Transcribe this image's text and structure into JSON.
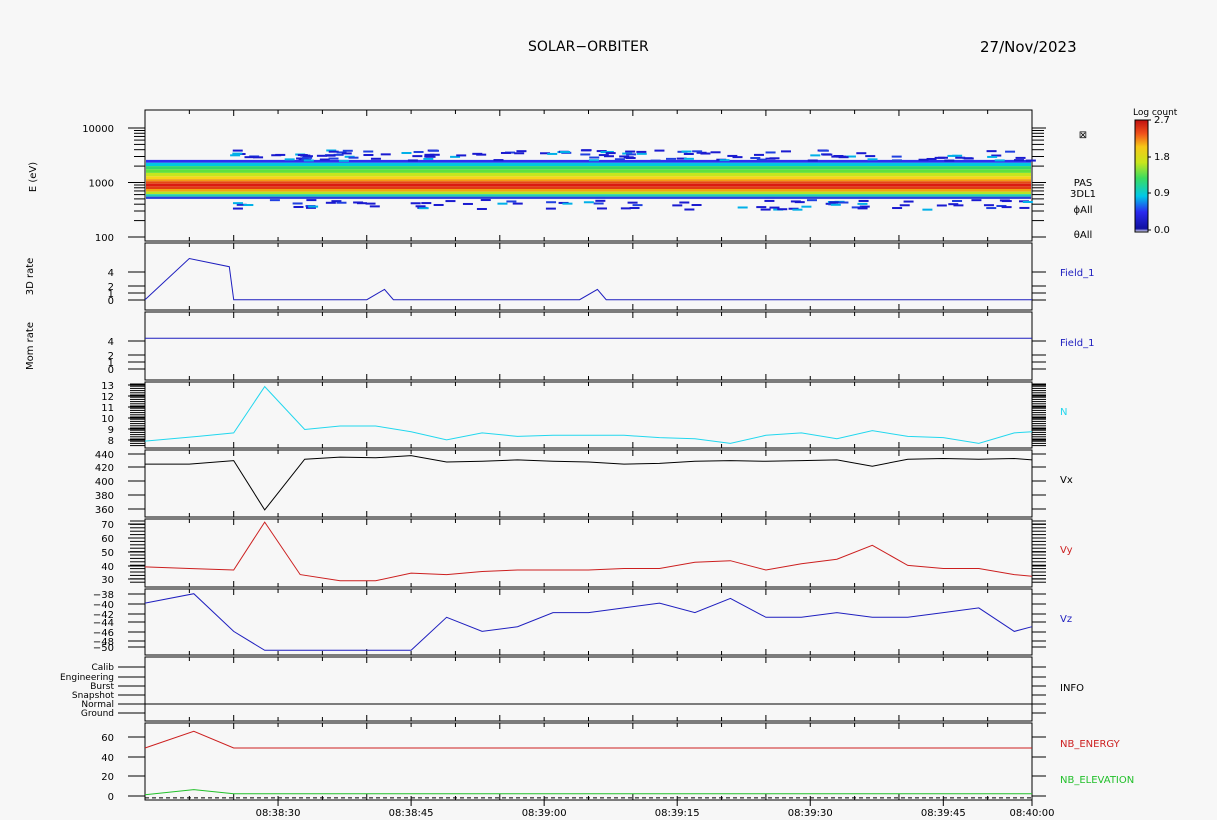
{
  "header": {
    "title": "SOLAR−ORBITER",
    "date": "27/Nov/2023"
  },
  "chart_data": [
    {
      "type": "heatmap",
      "panel": "spectrogram",
      "ylabel": "E (eV)",
      "yscale": "log",
      "yticks": [
        {
          "v": 10000,
          "label": "10000"
        },
        {
          "v": 1000,
          "label": "1000"
        },
        {
          "v": 100,
          "label": "100"
        }
      ],
      "ylim": [
        100,
        10000
      ],
      "right_labels": [
        "⊠",
        "PAS",
        "3DL1",
        "ϕAll",
        "θAll"
      ],
      "colorbar": {
        "title": "Log count",
        "ticks": [
          "2.7",
          "1.8",
          "0.9",
          "0.0"
        ],
        "range": [
          0.0,
          2.7
        ]
      },
      "band": {
        "e_min": 450,
        "e_max": 2600,
        "e_peak": 900
      }
    },
    {
      "type": "line",
      "panel": "rate3d",
      "ylabel": "3D rate",
      "yticks": [
        "4",
        "2",
        "1",
        "0"
      ],
      "ylim": [
        0,
        6.5
      ],
      "series": [
        {
          "name": "Field_1",
          "color": "#1f1fbf",
          "x": [
            0,
            5,
            9.5,
            10,
            25,
            27,
            28,
            49,
            51,
            52,
            100
          ],
          "y": [
            1,
            5,
            4.2,
            1,
            1,
            2,
            1,
            1,
            2,
            1,
            1
          ]
        }
      ]
    },
    {
      "type": "line",
      "panel": "momrate",
      "ylabel": "Mom rate",
      "yticks": [
        "4",
        "2",
        "1",
        "0"
      ],
      "ylim": [
        0,
        6.5
      ],
      "series": [
        {
          "name": "Field_1",
          "color": "#1f1fbf",
          "x": [
            0,
            100
          ],
          "y": [
            4,
            4
          ]
        }
      ]
    },
    {
      "type": "line",
      "panel": "density",
      "yticks": [
        "13",
        "12",
        "11",
        "10",
        "9",
        "8"
      ],
      "ylim": [
        7.5,
        13.2
      ],
      "series": [
        {
          "name": "N",
          "color": "#22d7ee",
          "x": [
            0,
            6,
            10,
            13.5,
            18,
            22,
            26,
            30,
            34,
            38,
            42,
            46,
            50,
            54,
            58,
            62,
            66,
            70,
            74,
            78,
            82,
            86,
            90,
            94,
            98,
            100
          ],
          "y": [
            8.1,
            8.5,
            8.8,
            12.8,
            9.1,
            9.4,
            9.4,
            8.9,
            8.2,
            8.8,
            8.5,
            8.6,
            8.6,
            8.6,
            8.4,
            8.3,
            7.9,
            8.6,
            8.8,
            8.3,
            9.0,
            8.5,
            8.4,
            7.9,
            8.8,
            8.9
          ]
        }
      ]
    },
    {
      "type": "line",
      "panel": "vx",
      "yticks": [
        "440",
        "420",
        "400",
        "380",
        "360"
      ],
      "ylim": [
        350,
        445
      ],
      "series": [
        {
          "name": "Vx",
          "color": "#000000",
          "x": [
            0,
            5,
            10,
            13.5,
            18,
            22,
            26,
            30,
            34,
            38,
            42,
            46,
            50,
            54,
            58,
            62,
            66,
            70,
            74,
            78,
            82,
            86,
            90,
            94,
            98,
            100
          ],
          "y": [
            425,
            425,
            430,
            360,
            432,
            435,
            434,
            437,
            428,
            429,
            431,
            429,
            428,
            425,
            426,
            429,
            430,
            429,
            430,
            431,
            422,
            432,
            433,
            432,
            433,
            431
          ]
        }
      ]
    },
    {
      "type": "line",
      "panel": "vy",
      "yticks": [
        "70",
        "60",
        "50",
        "40",
        "30"
      ],
      "ylim": [
        28,
        72
      ],
      "series": [
        {
          "name": "Vy",
          "color": "#cc1f1f",
          "x": [
            0,
            5,
            10,
            13.5,
            17.5,
            22,
            26,
            30,
            34,
            38,
            42,
            46,
            50,
            54,
            58,
            62,
            66,
            70,
            74,
            78,
            82,
            86,
            90,
            94,
            98,
            100
          ],
          "y": [
            41,
            40,
            39,
            70,
            36,
            32,
            32,
            37,
            36,
            38,
            39,
            39,
            39,
            40,
            40,
            44,
            45,
            39,
            43,
            46,
            55,
            42,
            40,
            40,
            36,
            35
          ]
        }
      ]
    },
    {
      "type": "line",
      "panel": "vz",
      "yticks": [
        "−38",
        "−40",
        "−42",
        "−44",
        "−46",
        "−48",
        "−50"
      ],
      "ylim": [
        -51,
        -37
      ],
      "series": [
        {
          "name": "Vz",
          "color": "#1f1fbf",
          "x": [
            0,
            5.5,
            10,
            13.5,
            17,
            22,
            26,
            30,
            34,
            38,
            42,
            46,
            50,
            54,
            58,
            62,
            66,
            70,
            74,
            78,
            82,
            86,
            90,
            94,
            98,
            100
          ],
          "y": [
            -40,
            -38,
            -46,
            -50,
            -50,
            -50,
            -50,
            -50,
            -43,
            -46,
            -45,
            -42,
            -42,
            -41,
            -40,
            -42,
            -39,
            -43,
            -43,
            -42,
            -43,
            -43,
            -42,
            -41,
            -46,
            -45
          ]
        }
      ]
    },
    {
      "type": "line",
      "panel": "info",
      "yticks": [
        "Calib",
        "Engineering",
        "Burst",
        "Snapshot",
        "Normal",
        "Ground"
      ],
      "series": [
        {
          "name": "INFO",
          "color": "#000000",
          "x": [
            0,
            100
          ],
          "y": [
            4,
            4
          ]
        }
      ]
    },
    {
      "type": "line",
      "panel": "nb",
      "yticks": [
        "60",
        "40",
        "20",
        "0"
      ],
      "ylim": [
        -2,
        72
      ],
      "xticks": [
        "08:38:30",
        "08:38:45",
        "08:39:00",
        "08:39:15",
        "08:39:30",
        "08:39:45",
        "08:40:00"
      ],
      "series": [
        {
          "name": "NB_ENERGY",
          "color": "#cc1f1f",
          "x": [
            0,
            5.5,
            10,
            100
          ],
          "y": [
            48,
            64,
            48,
            48
          ]
        },
        {
          "name": "NB_ELEVATION",
          "color": "#22c02b",
          "x": [
            0,
            5.5,
            10,
            100
          ],
          "y": [
            3,
            8,
            4,
            4
          ]
        }
      ]
    }
  ]
}
